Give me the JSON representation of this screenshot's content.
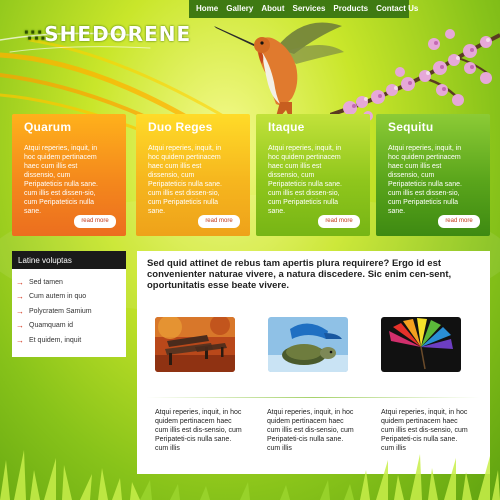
{
  "brand": {
    "logo_prefix": "∵∴",
    "logo_text": "SHEDORENE"
  },
  "nav": [
    "Home",
    "Gallery",
    "About",
    "Services",
    "Products",
    "Contact Us"
  ],
  "features": [
    {
      "title": "Quarum",
      "text": "Atqui reperies, inquit, in hoc quidem pertinacem haec cum illis est dissensio, cum Peripateticis nulla sane. cum illis est dissen-sio, cum Peripateticis nulla sane.",
      "more": "read more"
    },
    {
      "title": "Duo Reges",
      "text": "Atqui reperies, inquit, in hoc quidem pertinacem haec cum illis est dissensio, cum Peripateticis nulla sane. cum illis est dissen-sio, cum Peripateticis nulla sane.",
      "more": "read more"
    },
    {
      "title": "Itaque",
      "text": "Atqui reperies, inquit, in hoc quidem pertinacem haec cum illis est dissensio, cum Peripateticis nulla sane. cum illis est dissen-sio, cum Peripateticis nulla sane.",
      "more": "read more"
    },
    {
      "title": "Sequitu",
      "text": "Atqui reperies, inquit, in hoc quidem pertinacem haec cum illis est dissensio, cum Peripateticis nulla sane. cum illis est dissen-sio, cum Peripateticis nulla sane.",
      "more": "read more"
    }
  ],
  "sidebar": {
    "title": "Latine voluptas",
    "items": [
      "Sed tamen",
      "Cum autem in quo",
      "Polycratem Samium",
      "Quamquam id",
      "Et quidem, inquit"
    ]
  },
  "main": {
    "lead": "Sed quid attinet de rebus tam apertis plura requirere? Ergo id est convenienter naturae vivere, a natura discedere. Sic enim cen-sent, oportunitatis esse beate vivere.",
    "columns": [
      "Atqui reperies, inquit, in hoc quidem pertinacem haec cum illis est dis-sensio, cum Peripateti-cis nulla sane. cum illis",
      "Atqui reperies, inquit, in hoc quidem pertinacem haec cum illis est dis-sensio, cum Peripateti-cis nulla sane. cum illis",
      "Atqui reperies, inquit, in hoc quidem pertinacem haec cum illis est dis-sensio, cum Peripateti-cis nulla sane. cum illis"
    ]
  },
  "colors": {
    "nav_bg": "#3f7a12",
    "accent_red": "#d2321a",
    "box_orange": "#f4881c",
    "box_yellow": "#f6b61e",
    "box_lightgreen": "#8fc61c",
    "box_green": "#5aa51b"
  },
  "icons": [
    "hummingbird-image",
    "blossom-branch-image",
    "bench-autumn-image",
    "turtle-image",
    "colorful-leaves-image",
    "grass-decoration",
    "arrow-right-icon"
  ]
}
